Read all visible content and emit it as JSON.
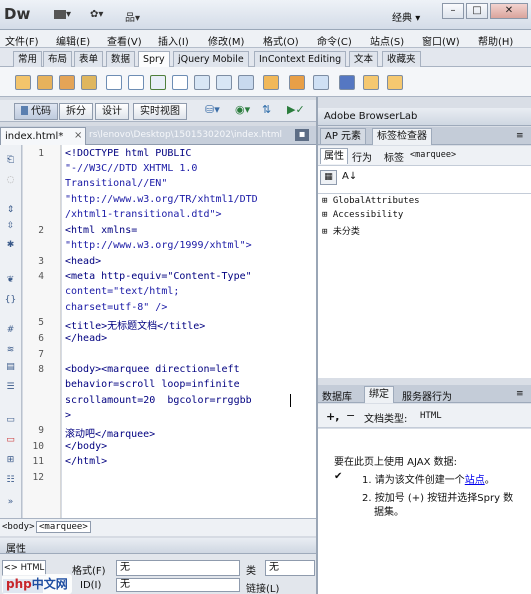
{
  "app": {
    "logo": "Dw",
    "workspace": "经典",
    "workspace_arrow": "▾"
  },
  "window_buttons": {
    "minimize": "–",
    "restore": "□",
    "close": "✕"
  },
  "toolbar_top": {
    "layout_arrow": "▾",
    "gear": "✿▾",
    "site": "品▾"
  },
  "menu": [
    "文件(F)",
    "编辑(E)",
    "查看(V)",
    "插入(I)",
    "修改(M)",
    "格式(O)",
    "命令(C)",
    "站点(S)",
    "窗口(W)",
    "帮助(H)"
  ],
  "insert_tabs": [
    "常用",
    "布局",
    "表单",
    "数据",
    "Spry",
    "jQuery Mobile",
    "InContext Editing",
    "文本",
    "收藏夹"
  ],
  "insert_tabs_active": "Spry",
  "view_buttons": [
    "代码",
    "拆分",
    "设计",
    "实时视图"
  ],
  "view_icons": [
    "globe-check",
    "preview",
    "refresh",
    "validate"
  ],
  "doc_tab": {
    "name": "index.html*",
    "close": "×",
    "path": "rs\\lenovo\\Desktop\\1501530202\\index.html"
  },
  "gutter_icons": [
    "open-docs-icon",
    "collapse-icon",
    "expand-icon",
    "select-parent-icon",
    "balance-icon",
    "line-num-icon",
    "highlight-icon",
    "wrap-icon",
    "syntax-icon",
    "comment-icon",
    "uncomment-icon",
    "wrap-tag-icon",
    "recent-snippets-icon",
    "move-css-icon",
    "indent-icon",
    "outdent-icon",
    "format-icon"
  ],
  "line_numbers": [
    "1",
    "2",
    "3",
    "4",
    "5",
    "6",
    "7",
    "8",
    "9",
    "10",
    "11",
    "12"
  ],
  "code_lines": [
    "<!DOCTYPE html PUBLIC",
    "\"-//W3C//DTD XHTML 1.0",
    "Transitional//EN\"",
    "\"http://www.w3.org/TR/xhtml1/DTD",
    "/xhtml1-transitional.dtd\">",
    "<html xmlns=",
    "\"http://www.w3.org/1999/xhtml\">",
    "<head>",
    "<meta http-equiv=\"Content-Type\"",
    "content=\"text/html;",
    "charset=utf-8\" />",
    "<title>无标题文档</title>",
    "</head>",
    "",
    "<body><marquee direction=left",
    "behavior=scroll loop=infinite",
    "scrollamount=20  bgcolor=rrggbb",
    ">",
    "滚动吧</marquee>",
    "</body>",
    "</html>"
  ],
  "breadcrumb": {
    "body": "<body>",
    "marquee": "<marquee>"
  },
  "properties": {
    "title": "属性",
    "html_btn": "<> HTML",
    "css_btn": "css",
    "format_label": "格式(F)",
    "format_value": "无",
    "id_label": "ID(I)",
    "id_value": "无",
    "class_label": "类",
    "class_value": "无",
    "link_label": "链接(L)"
  },
  "right_top": {
    "title": "Adobe BrowserLab"
  },
  "right_tabs": {
    "ap": "AP 元素",
    "tag_inspector": "标签检查器"
  },
  "tag_inspector": {
    "tab1": "属性",
    "tab2": "行为",
    "tab3_label": "标签",
    "tag": "<marquee>",
    "categories": [
      "GlobalAttributes",
      "Accessibility",
      "未分类"
    ]
  },
  "bottom_tabs": {
    "database": "数据库",
    "bindings": "绑定",
    "server_behaviors": "服务器行为"
  },
  "bindings": {
    "add": "+,",
    "remove": "−",
    "doc_type_label": "文档类型:",
    "doc_type_value": "HTML",
    "instruction": "要在此页上使用 AJAX 数据:",
    "step1_prefix": "1. 请为该文件创建一个",
    "step1_link": "站点",
    "step1_suffix": "。",
    "step2_line1": "2. 按加号 (+) 按钮并选择Spry 数",
    "step2_line2": "据集。",
    "check": "✔"
  },
  "watermark": "中文网",
  "colors": {
    "accent": "#2f5d9e",
    "code_tag": "#000080",
    "link": "#0000ee"
  }
}
